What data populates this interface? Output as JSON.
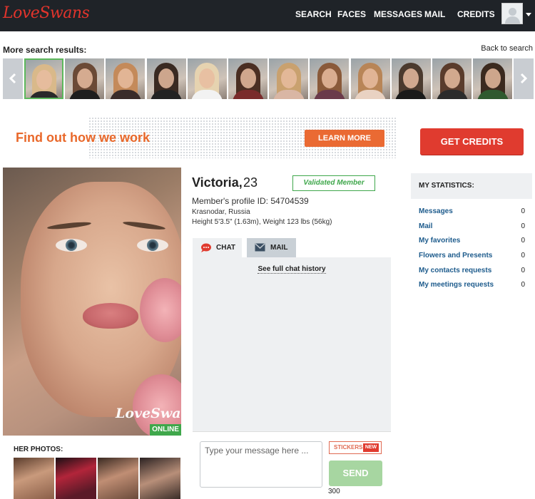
{
  "header": {
    "logo": "LoveSwans",
    "nav": [
      "SEARCH",
      "FACES",
      "MESSAGES",
      "MAIL",
      "CREDITS"
    ]
  },
  "search_results": {
    "title": "More search results:",
    "back_label": "Back to search"
  },
  "banner": {
    "text": "Find out how we work",
    "learn_more": "LEARN MORE"
  },
  "get_credits": "GET CREDITS",
  "profile": {
    "name": "Victoria,",
    "age": "23",
    "validated": "Validated Member",
    "profile_id": "Member's profile ID: 54704539",
    "location": "Krasnodar, Russia",
    "height_weight": "Height 5'3.5\" (1.63m), Weight 123 lbs (56kg)",
    "watermark": "LoveSwans",
    "status": "ONLINE",
    "photos_title": "HER PHOTOS:"
  },
  "chat": {
    "tab_chat": "CHAT",
    "tab_mail": "MAIL",
    "history_link": "See full chat history",
    "placeholder": "Type your message here ...",
    "stickers": "STICKERS",
    "stickers_badge": "NEW",
    "send": "SEND",
    "char_count": "300"
  },
  "statistics": {
    "title": "MY STATISTICS:",
    "rows": [
      {
        "label": "Messages",
        "value": "0"
      },
      {
        "label": "Mail",
        "value": "0"
      },
      {
        "label": "My favorites",
        "value": "0"
      },
      {
        "label": "Flowers and Presents",
        "value": "0"
      },
      {
        "label": "My contacts requests",
        "value": "0"
      },
      {
        "label": "My meetings requests",
        "value": "0"
      }
    ]
  },
  "colors": {
    "brand_red": "#e1342c",
    "accent_orange": "#e9682a",
    "online_green": "#3fa74b",
    "link_blue": "#1d5b8c"
  }
}
